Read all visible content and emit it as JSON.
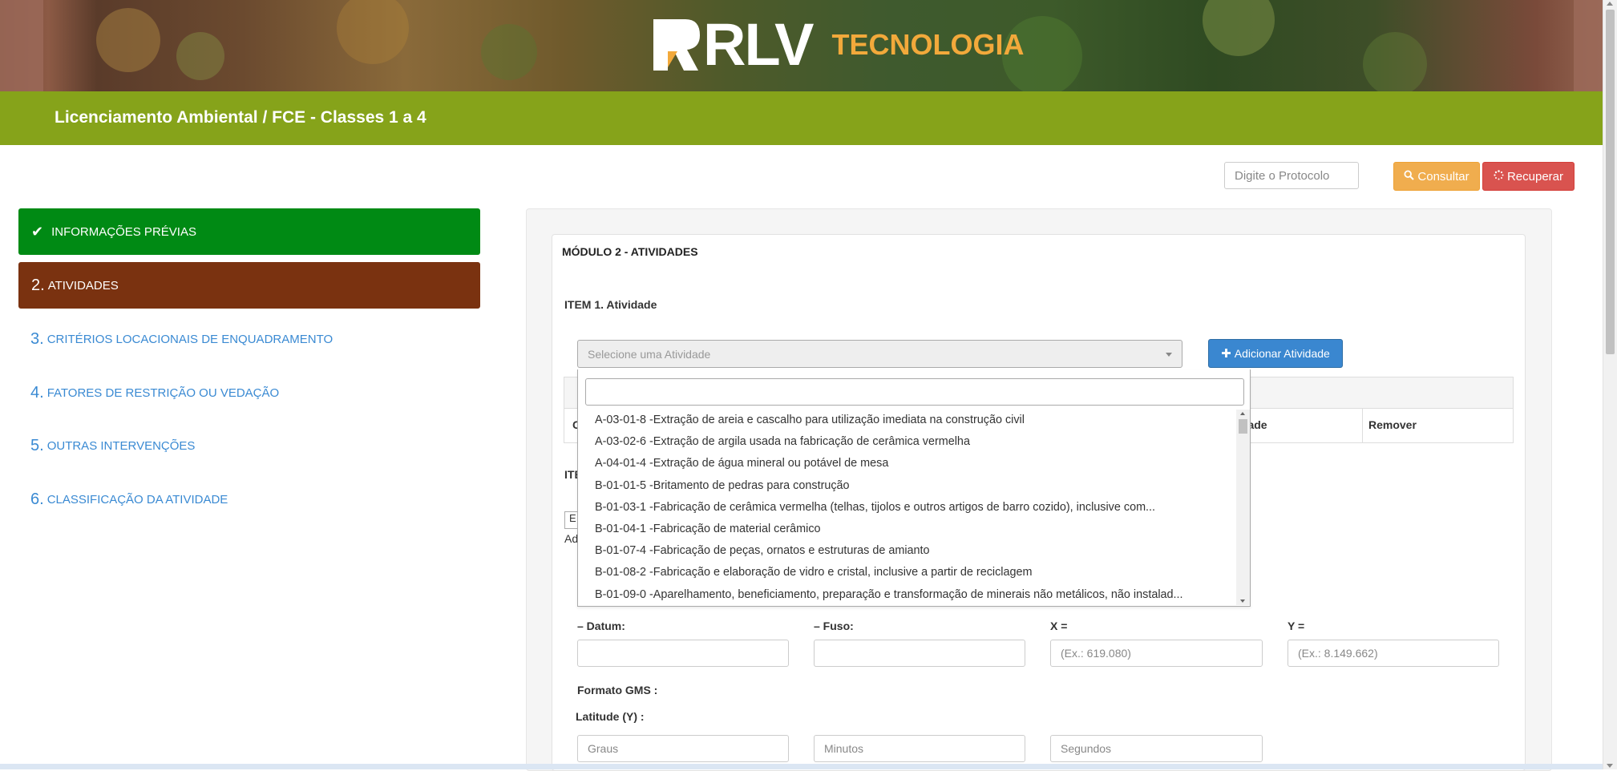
{
  "brand": {
    "logo_mark": "RLV",
    "logo_sub": "TECNOLOGIA"
  },
  "header": {
    "title": "Licenciamento Ambiental / FCE - Classes 1 a 4"
  },
  "search": {
    "placeholder": "Digite o Protocolo",
    "consult_label": "Consultar",
    "recover_label": "Recuperar"
  },
  "sidebar": {
    "items": [
      {
        "num": "",
        "label": "INFORMAÇÕES PRÉVIAS",
        "state": "done"
      },
      {
        "num": "2.",
        "label": "ATIVIDADES",
        "state": "active"
      },
      {
        "num": "3.",
        "label": "CRITÉRIOS LOCACIONAIS DE ENQUADRAMENTO",
        "state": "pending"
      },
      {
        "num": "4.",
        "label": "FATORES DE RESTRIÇÃO OU VEDAÇÃO",
        "state": "pending"
      },
      {
        "num": "5.",
        "label": "OUTRAS INTERVENÇÕES",
        "state": "pending"
      },
      {
        "num": "6.",
        "label": "CLASSIFICAÇÃO DA ATIVIDADE",
        "state": "pending"
      }
    ]
  },
  "main": {
    "module_title": "MÓDULO 2 - ATIVIDADES",
    "item1_label": "ITEM 1. Atividade",
    "select_placeholder": "Selecione uma Atividade",
    "add_button": "Adicionar Atividade",
    "table_cols": {
      "first": "C",
      "unit": "idade",
      "remove": "Remover"
    },
    "item2_partial": "ITE",
    "small_box": "E",
    "small_text": "Ad"
  },
  "dropdown": {
    "search_value": "",
    "options": [
      "A-03-01-8 -Extração de areia e cascalho para utilização imediata na construção civil",
      "A-03-02-6 -Extração de argila usada na fabricação de cerâmica vermelha",
      "A-04-01-4 -Extração de água mineral ou potável de mesa",
      "B-01-01-5 -Britamento de pedras para construção",
      "B-01-03-1 -Fabricação de cerâmica vermelha (telhas, tijolos e outros artigos de barro cozido), inclusive com...",
      "B-01-04-1 -Fabricação de material cerâmico",
      "B-01-07-4 -Fabricação de peças, ornatos e estruturas de amianto",
      "B-01-08-2 -Fabricação e elaboração de vidro e cristal, inclusive a partir de reciclagem",
      "B-01-09-0 -Aparelhamento, beneficiamento, preparação e transformação de minerais não metálicos, não instalad..."
    ]
  },
  "coords": {
    "datum_label": "– Datum:",
    "fuso_label": "– Fuso:",
    "x_label": "X =",
    "y_label": "Y =",
    "x_placeholder": "(Ex.: 619.080)",
    "y_placeholder": "(Ex.: 8.149.662)",
    "gms_label": "Formato GMS :",
    "lat_label": "Latitude (Y) :",
    "graus_placeholder": "Graus",
    "minutos_placeholder": "Minutos",
    "segundos_placeholder": "Segundos"
  },
  "colors": {
    "green_bar": "#86a31a",
    "done": "#008a14",
    "active": "#7a3210",
    "link": "#3a8ad3",
    "consult": "#f0ad4e",
    "recover": "#d9534f",
    "add": "#3a87d0",
    "logo_sub": "#f2a93b"
  }
}
